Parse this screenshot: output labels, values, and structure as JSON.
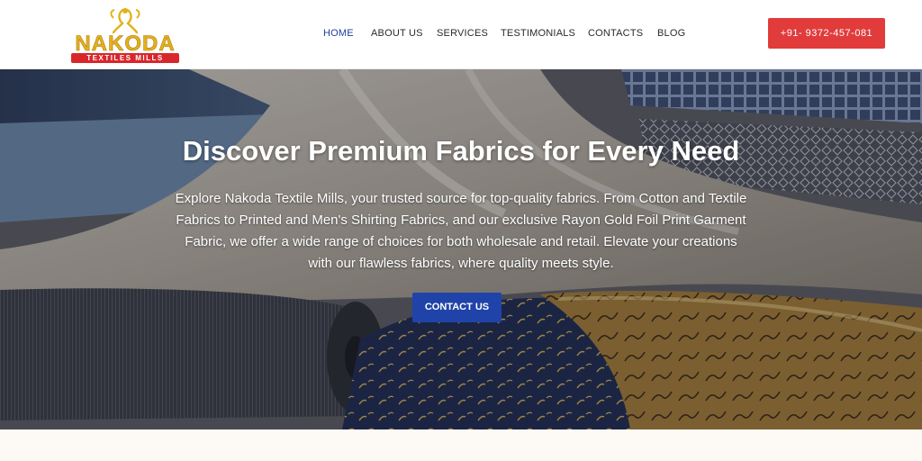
{
  "brand": {
    "name": "NAKODA",
    "subtitle": "TEXTILES MILLS",
    "gold": "#e2b21b",
    "red": "#d8272c"
  },
  "nav": {
    "items": [
      {
        "label": "HOME",
        "active": true
      },
      {
        "label": "ABOUT US",
        "active": false
      },
      {
        "label": "SERVICES",
        "active": false
      },
      {
        "label": "TESTIMONIALS",
        "active": false
      },
      {
        "label": "CONTACTS",
        "active": false
      },
      {
        "label": "BLOG",
        "active": false
      }
    ],
    "active_color": "#1f3f9a"
  },
  "header": {
    "phone_label": "+91- 9372-457-081",
    "phone_color": "#e23b3b"
  },
  "hero": {
    "title": "Discover Premium Fabrics for Every Need",
    "description": "Explore Nakoda Textile Mills, your trusted source for top-quality fabrics. From Cotton and Textile Fabrics to Printed and Men's Shirting Fabrics, and our exclusive Rayon Gold Foil Print Garment Fabric, we offer a wide range of choices for both wholesale and retail. Elevate your creations with our flawless fabrics, where quality meets style.",
    "cta_label": "CONTACT US",
    "cta_color": "#1f43a8"
  }
}
